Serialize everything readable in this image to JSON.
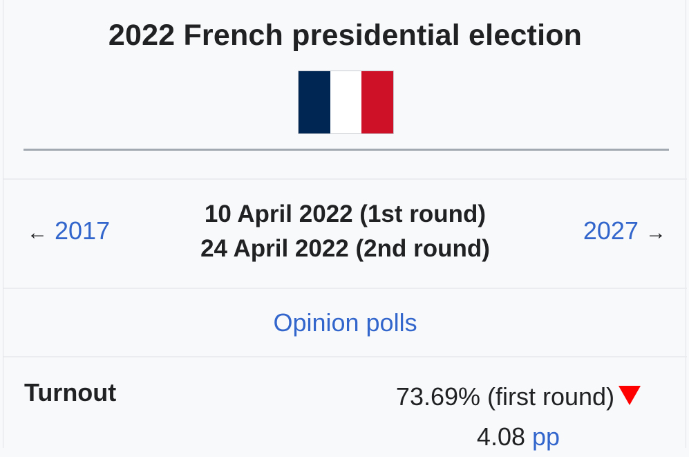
{
  "infobox": {
    "title": "2022 French presidential election",
    "flag": {
      "icon": "flag-of-france-icon",
      "colors": [
        "#002654",
        "#ffffff",
        "#ce1126"
      ]
    },
    "nav": {
      "prev_arrow": "←",
      "prev_year": "2017",
      "next_year": "2027",
      "next_arrow": "→",
      "dates": [
        "10 April 2022 (1st round)",
        "24 April 2022 (2nd round)"
      ]
    },
    "opinion_polls": "Opinion polls",
    "turnout": {
      "label": "Turnout",
      "value": "73.69% (first round)",
      "change_icon": "decrease-triangle-icon",
      "change_value": "4.08",
      "change_unit": "pp"
    }
  },
  "colors": {
    "link": "#3366cc",
    "decrease": "#ff0000",
    "text": "#202122"
  }
}
